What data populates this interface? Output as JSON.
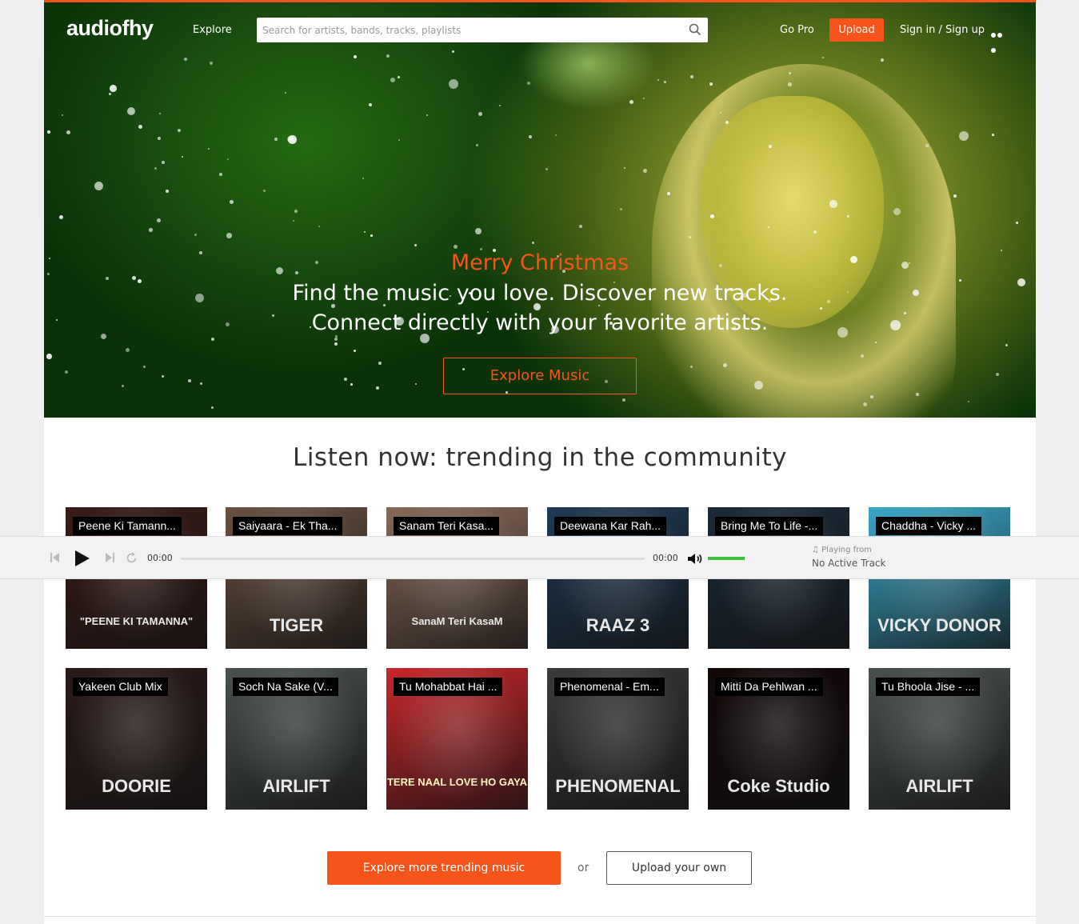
{
  "header": {
    "logo": "audiofhy",
    "explore": "Explore",
    "search_placeholder": "Search for artists, bands, tracks, playlists",
    "go_pro": "Go Pro",
    "upload": "Upload",
    "sign_in": "Sign in / Sign up"
  },
  "hero": {
    "greeting": "Merry Christmas",
    "line1": "Find the music you love. Discover new tracks.",
    "line2": "Connect directly with your favorite artists.",
    "cta": "Explore Music"
  },
  "trending": {
    "title": "Listen now: trending in the community",
    "tiles": [
      {
        "label": "Peene Ki Tamann...",
        "art": "\"PEENE KI TAMANNA\"",
        "bg": "#3a1a16"
      },
      {
        "label": "Saiyaara - Ek Tha...",
        "art": "TIGER",
        "bg": "#6a5040"
      },
      {
        "label": "Sanam Teri Kasa...",
        "art": "SanaM Teri KasaM",
        "bg": "#8a6a58"
      },
      {
        "label": "Deewana Kar Rah...",
        "art": "RAAZ 3",
        "bg": "#1e3a55"
      },
      {
        "label": "Bring Me To Life -...",
        "art": "",
        "bg": "#1a2a3a"
      },
      {
        "label": "Chaddha - Vicky ...",
        "art": "VICKY DONOR",
        "bg": "#3aa8c8"
      },
      {
        "label": "Yakeen Club Mix",
        "art": "DOORIE",
        "bg": "#2a1a18"
      },
      {
        "label": "Soch Na Sake (V...",
        "art": "AIRLIFT",
        "bg": "#4a5050"
      },
      {
        "label": "Tu Mohabbat Hai ...",
        "art": "TERE NAAL LOVE HO GAYA",
        "bg": "#c8262a"
      },
      {
        "label": "Phenomenal - Em...",
        "art": "PHENOMENAL",
        "bg": "#3a3a3a"
      },
      {
        "label": "Mitti Da Pehlwan ...",
        "art": "Coke Studio",
        "bg": "#120808"
      },
      {
        "label": "Tu Bhoola Jise - ...",
        "art": "AIRLIFT",
        "bg": "#4a5050"
      }
    ]
  },
  "player": {
    "time_current": "00:00",
    "time_total": "00:00",
    "playing_from": "Playing from",
    "active_track": "No Active Track"
  },
  "actions": {
    "explore_more": "Explore more trending music",
    "or": "or",
    "upload_own": "Upload your own"
  },
  "colors": {
    "brand": "#f6541a",
    "volume": "#3cbf3c"
  }
}
